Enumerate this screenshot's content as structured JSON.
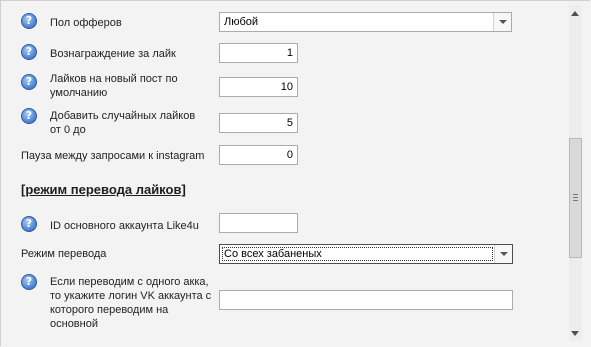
{
  "settings": {
    "offer_gender": {
      "label": "Пол офферов",
      "value": "Любой"
    },
    "like_reward": {
      "label": "Вознаграждение за лайк",
      "value": "1"
    },
    "default_likes": {
      "label": "Лайков на новый пост по умолчанию",
      "value": "10"
    },
    "random_likes": {
      "label": "Добавить случайных лайков от 0 до",
      "value": "5"
    },
    "request_pause": {
      "label": "Пауза между запросами к instagram",
      "value": "0"
    }
  },
  "transfer_section": {
    "title": "[режим перевода лайков]",
    "main_account_id": {
      "label": "ID основного аккаунта Like4u",
      "value": ""
    },
    "transfer_mode": {
      "label": "Режим перевода",
      "value": "Со всех забаненых"
    },
    "vk_login": {
      "label": "Если переводим с одного акка, то укажите логин VK аккаунта с которого переводим на основной",
      "value": ""
    }
  },
  "icons": {
    "help": "help-question-icon",
    "scroll_up": "arrow-up-icon",
    "scroll_down": "arrow-down-icon"
  },
  "colors": {
    "panel_bg": "#f3f3f3",
    "help_icon": "#5a8fd9"
  }
}
